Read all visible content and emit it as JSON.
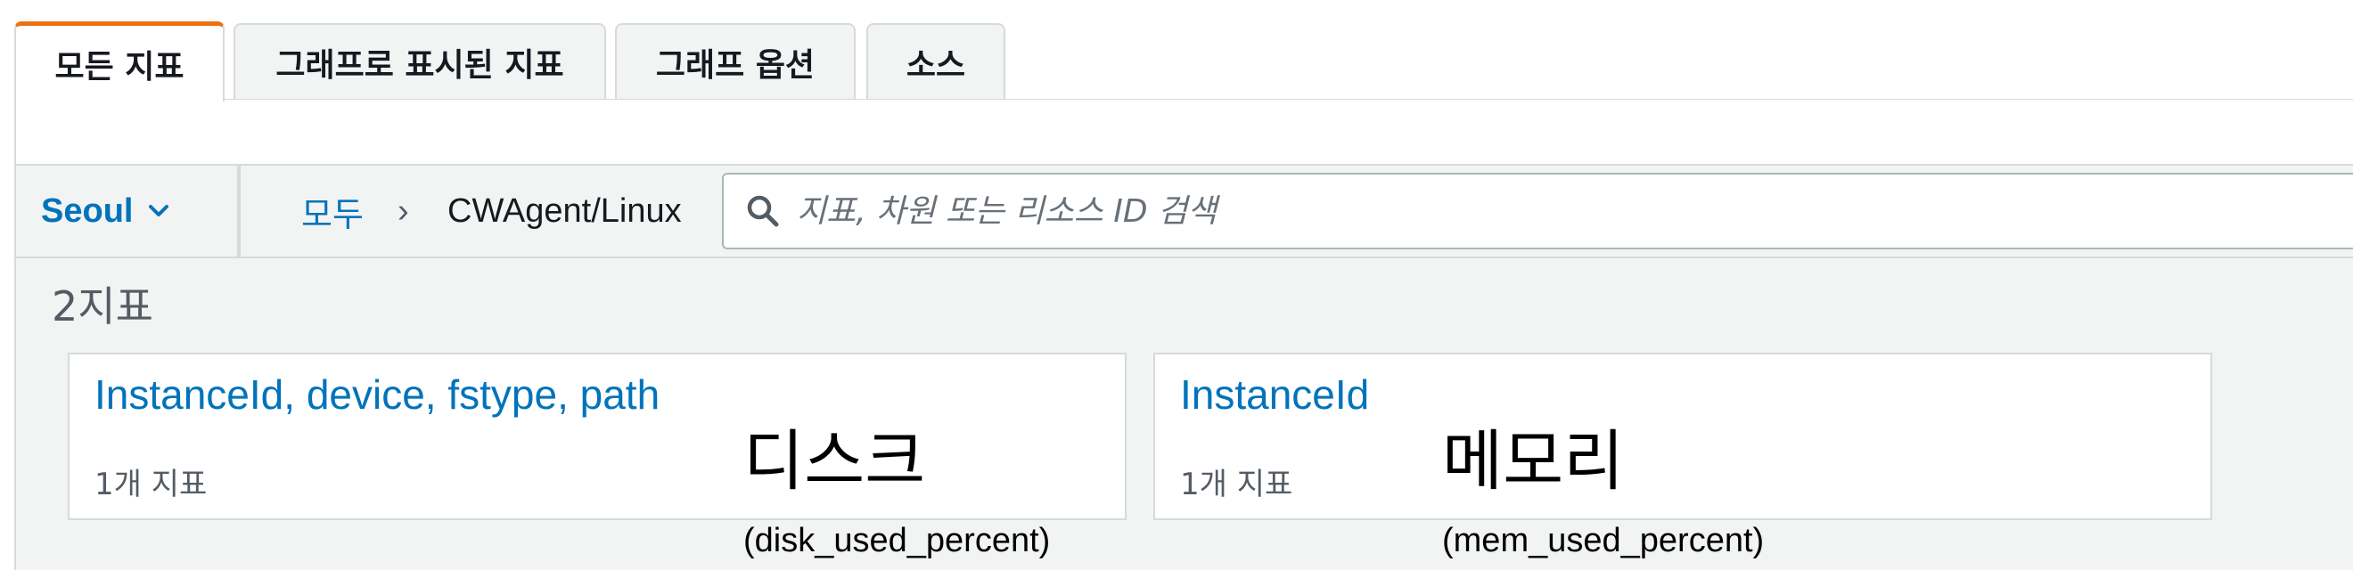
{
  "tabs": [
    {
      "label": "모든 지표",
      "active": true
    },
    {
      "label": "그래프로 표시된 지표",
      "active": false
    },
    {
      "label": "그래프 옵션",
      "active": false
    },
    {
      "label": "소스",
      "active": false
    }
  ],
  "toolbar": {
    "region": "Seoul",
    "breadcrumb_root": "모두",
    "breadcrumb_separator": "›",
    "breadcrumb_current": "CWAgent/Linux",
    "search_placeholder": "지표, 차원 또는 리소스 ID 검색"
  },
  "results": {
    "count_label": "2지표"
  },
  "cards": [
    {
      "title": "InstanceId, device, fstype, path",
      "subtitle": "1개 지표",
      "annotation": "디스크",
      "annotation_detail": "(disk_used_percent)"
    },
    {
      "title": "InstanceId",
      "subtitle": "1개 지표",
      "annotation": "메모리",
      "annotation_detail": "(mem_used_percent)"
    }
  ],
  "colors": {
    "accent": "#ec7211",
    "link": "#0073bb",
    "toolbar_bg": "#f2f3f3",
    "border": "#d5dbdb"
  },
  "icons": {
    "region_dropdown": "chevron-down-icon",
    "search": "search-icon"
  }
}
